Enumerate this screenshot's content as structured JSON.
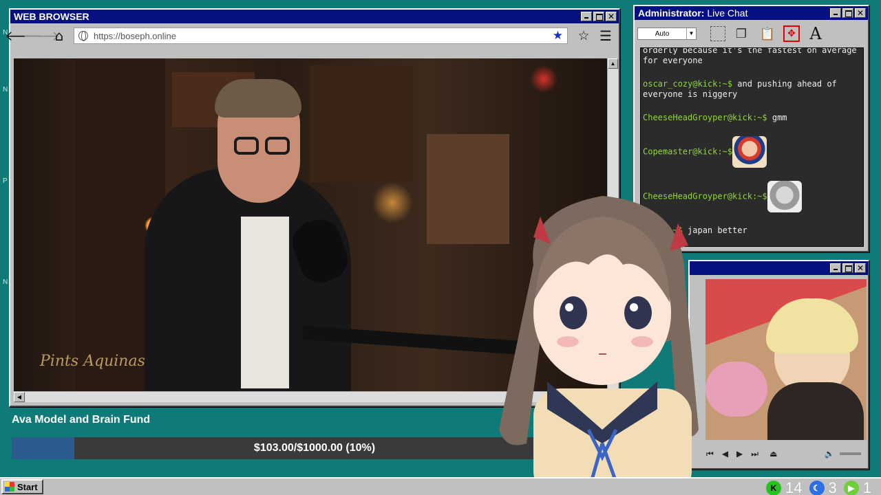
{
  "browser": {
    "title": "WEB BROWSER",
    "url": "https://boseph.online",
    "back_icon": "arrow-left-icon",
    "forward_icon": "arrow-right-icon",
    "home_icon": "home-icon",
    "bookmark_icon": "star-filled-icon",
    "favorite_icon": "star-outline-icon",
    "menu_icon": "hamburger-icon",
    "video_watermark": "Pints Aquinas"
  },
  "fund": {
    "title": "Ava Model and Brain Fund",
    "progress_text": "$103.00/$1000.00 (10%)",
    "raised": 103.0,
    "goal": 1000.0,
    "percent": 10
  },
  "chat": {
    "title_prefix": "Administrator:",
    "title_rest": " Live Chat",
    "zoom_select": "Auto",
    "messages": [
      {
        "user": "",
        "text": "orderly because it's the fastest on average for everyone"
      },
      {
        "user": "oscar_cozy@kick:~$",
        "text": " and pushing ahead of everyone is niggery"
      },
      {
        "user": "CheeseHeadGroyper@kick:~$",
        "text": " gmm"
      },
      {
        "user": "Copemaster@kick:~$",
        "text": "",
        "emote": "anime-face-emote"
      },
      {
        "user": "CheeseHeadGroyper@kick:~$",
        "text": "",
        "emote": "cat-face-emote"
      },
      {
        "user": "@kick:~$",
        "text": " japan better"
      }
    ]
  },
  "taskbar": {
    "start_label": "Start",
    "tray": [
      {
        "icon": "kick-icon",
        "count": "14"
      },
      {
        "icon": "moon-icon",
        "count": "3"
      },
      {
        "icon": "play-icon",
        "count": "1"
      }
    ]
  },
  "colors": {
    "desktop": "#0f7a78",
    "titlebar": "#06107f",
    "username": "#8fd63a",
    "fund_fill": "#2e5b8e"
  }
}
